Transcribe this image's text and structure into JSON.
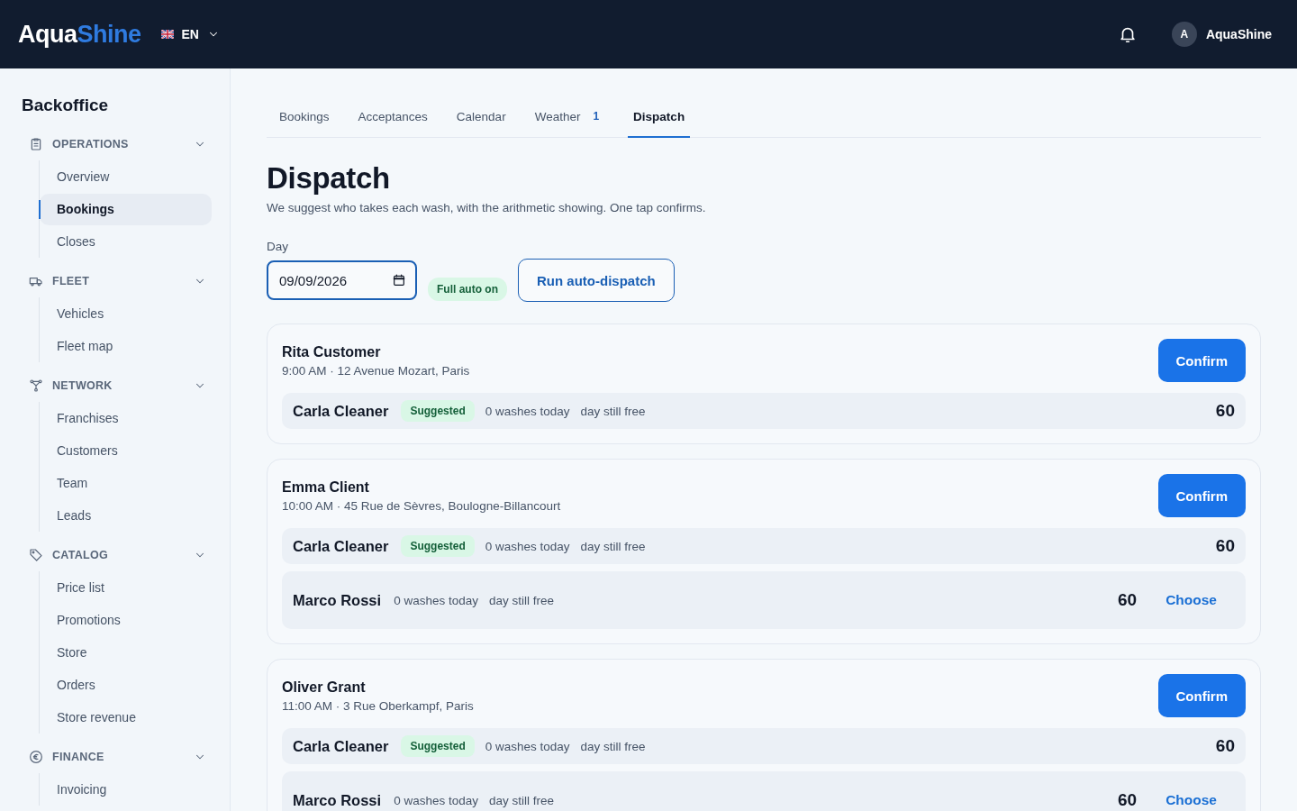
{
  "header": {
    "logo": {
      "first": "Aqua",
      "second": "Shine"
    },
    "language": "EN",
    "user": {
      "initial": "A",
      "name": "AquaShine"
    }
  },
  "sidebar": {
    "title": "Backoffice",
    "sections": [
      {
        "label": "OPERATIONS",
        "kind": "clipboard",
        "expanded": true,
        "items": [
          {
            "label": "Overview",
            "selected": false
          },
          {
            "label": "Bookings",
            "selected": true
          },
          {
            "label": "Closes",
            "selected": false
          }
        ]
      },
      {
        "label": "FLEET",
        "kind": "truck",
        "expanded": true,
        "items": [
          {
            "label": "Vehicles",
            "selected": false
          },
          {
            "label": "Fleet map",
            "selected": false
          }
        ]
      },
      {
        "label": "NETWORK",
        "kind": "network",
        "expanded": true,
        "items": [
          {
            "label": "Franchises",
            "selected": false
          },
          {
            "label": "Customers",
            "selected": false
          },
          {
            "label": "Team",
            "selected": false
          },
          {
            "label": "Leads",
            "selected": false
          }
        ]
      },
      {
        "label": "CATALOG",
        "kind": "tag",
        "expanded": true,
        "items": [
          {
            "label": "Price list",
            "selected": false
          },
          {
            "label": "Promotions",
            "selected": false
          },
          {
            "label": "Store",
            "selected": false
          },
          {
            "label": "Orders",
            "selected": false
          },
          {
            "label": "Store revenue",
            "selected": false
          }
        ]
      },
      {
        "label": "FINANCE",
        "kind": "euro",
        "expanded": true,
        "items": [
          {
            "label": "Invoicing",
            "selected": false
          }
        ]
      }
    ]
  },
  "tabs": [
    {
      "label": "Bookings",
      "selected": false
    },
    {
      "label": "Acceptances",
      "selected": false
    },
    {
      "label": "Calendar",
      "selected": false
    },
    {
      "label": "Weather",
      "selected": false,
      "badge": "1"
    },
    {
      "label": "Dispatch",
      "selected": true
    }
  ],
  "page": {
    "title": "Dispatch",
    "subtitle": "We suggest who takes each wash, with the arithmetic showing. One tap confirms.",
    "day_label": "Day",
    "date": "09/09/2026",
    "auto_badge": "Full auto on",
    "run_button": "Run auto-dispatch"
  },
  "bookings": [
    {
      "customer": "Rita Customer",
      "details": "9:00 AM · 12 Avenue Mozart, Paris",
      "confirm": "Confirm",
      "candidates": [
        {
          "name": "Carla Cleaner",
          "tag": "Suggested",
          "washes": "0 washes today",
          "availability": "day still free",
          "score": "60"
        }
      ]
    },
    {
      "customer": "Emma Client",
      "details": "10:00 AM · 45 Rue de Sèvres, Boulogne-Billancourt",
      "confirm": "Confirm",
      "candidates": [
        {
          "name": "Carla Cleaner",
          "tag": "Suggested",
          "washes": "0 washes today",
          "availability": "day still free",
          "score": "60"
        },
        {
          "name": "Marco Rossi",
          "washes": "0 washes today",
          "availability": "day still free",
          "score": "60",
          "action": "Choose"
        }
      ]
    },
    {
      "customer": "Oliver Grant",
      "details": "11:00 AM · 3 Rue Oberkampf, Paris",
      "confirm": "Confirm",
      "candidates": [
        {
          "name": "Carla Cleaner",
          "tag": "Suggested",
          "washes": "0 washes today",
          "availability": "day still free",
          "score": "60"
        },
        {
          "name": "Marco Rossi",
          "washes": "0 washes today",
          "availability": "day still free",
          "score": "60",
          "action": "Choose"
        }
      ]
    }
  ]
}
